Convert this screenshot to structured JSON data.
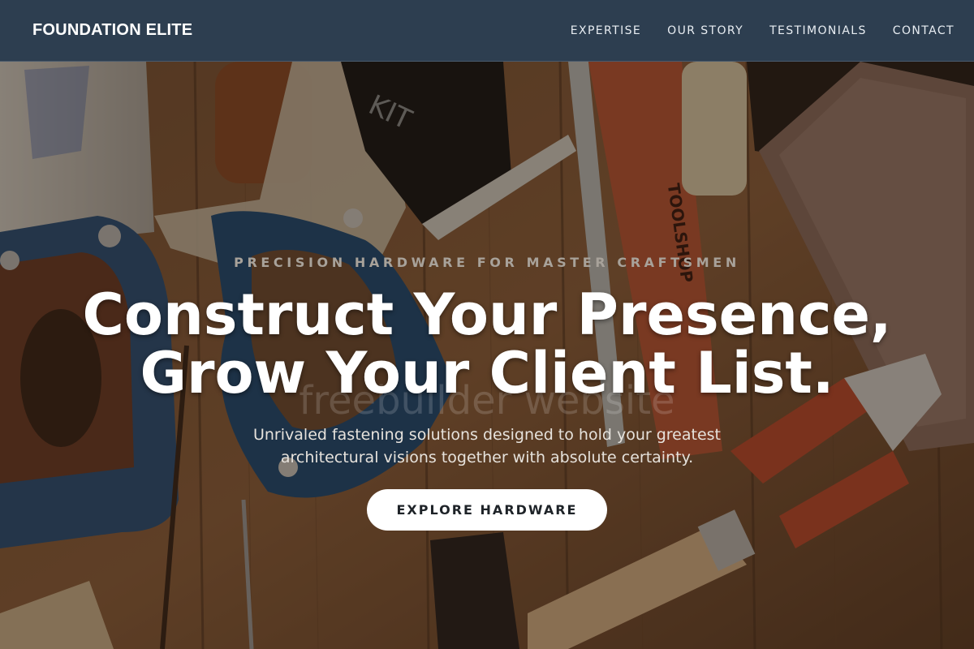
{
  "header": {
    "brand": "FOUNDATION ELITE",
    "nav": [
      {
        "label": "EXPERTISE"
      },
      {
        "label": "OUR STORY"
      },
      {
        "label": "TESTIMONIALS"
      },
      {
        "label": "CONTACT"
      }
    ]
  },
  "hero": {
    "eyebrow": "PRECISION HARDWARE FOR MASTER CRAFTSMEN",
    "headline_line1": "Construct Your Presence,",
    "headline_line2": "Grow Your Client List.",
    "watermark": "freebuilder website",
    "subtitle": "Unrivaled fastening solutions designed to hold your greatest architectural visions together with absolute certainty.",
    "cta_label": "EXPLORE HARDWARE",
    "background_image": "carpentry-tools-on-wooden-workbench"
  },
  "colors": {
    "navbar_bg": "#2d3e50",
    "cta_bg": "#ffffff",
    "headline_text": "#ffffff",
    "eyebrow_text": "#a8a29a"
  }
}
